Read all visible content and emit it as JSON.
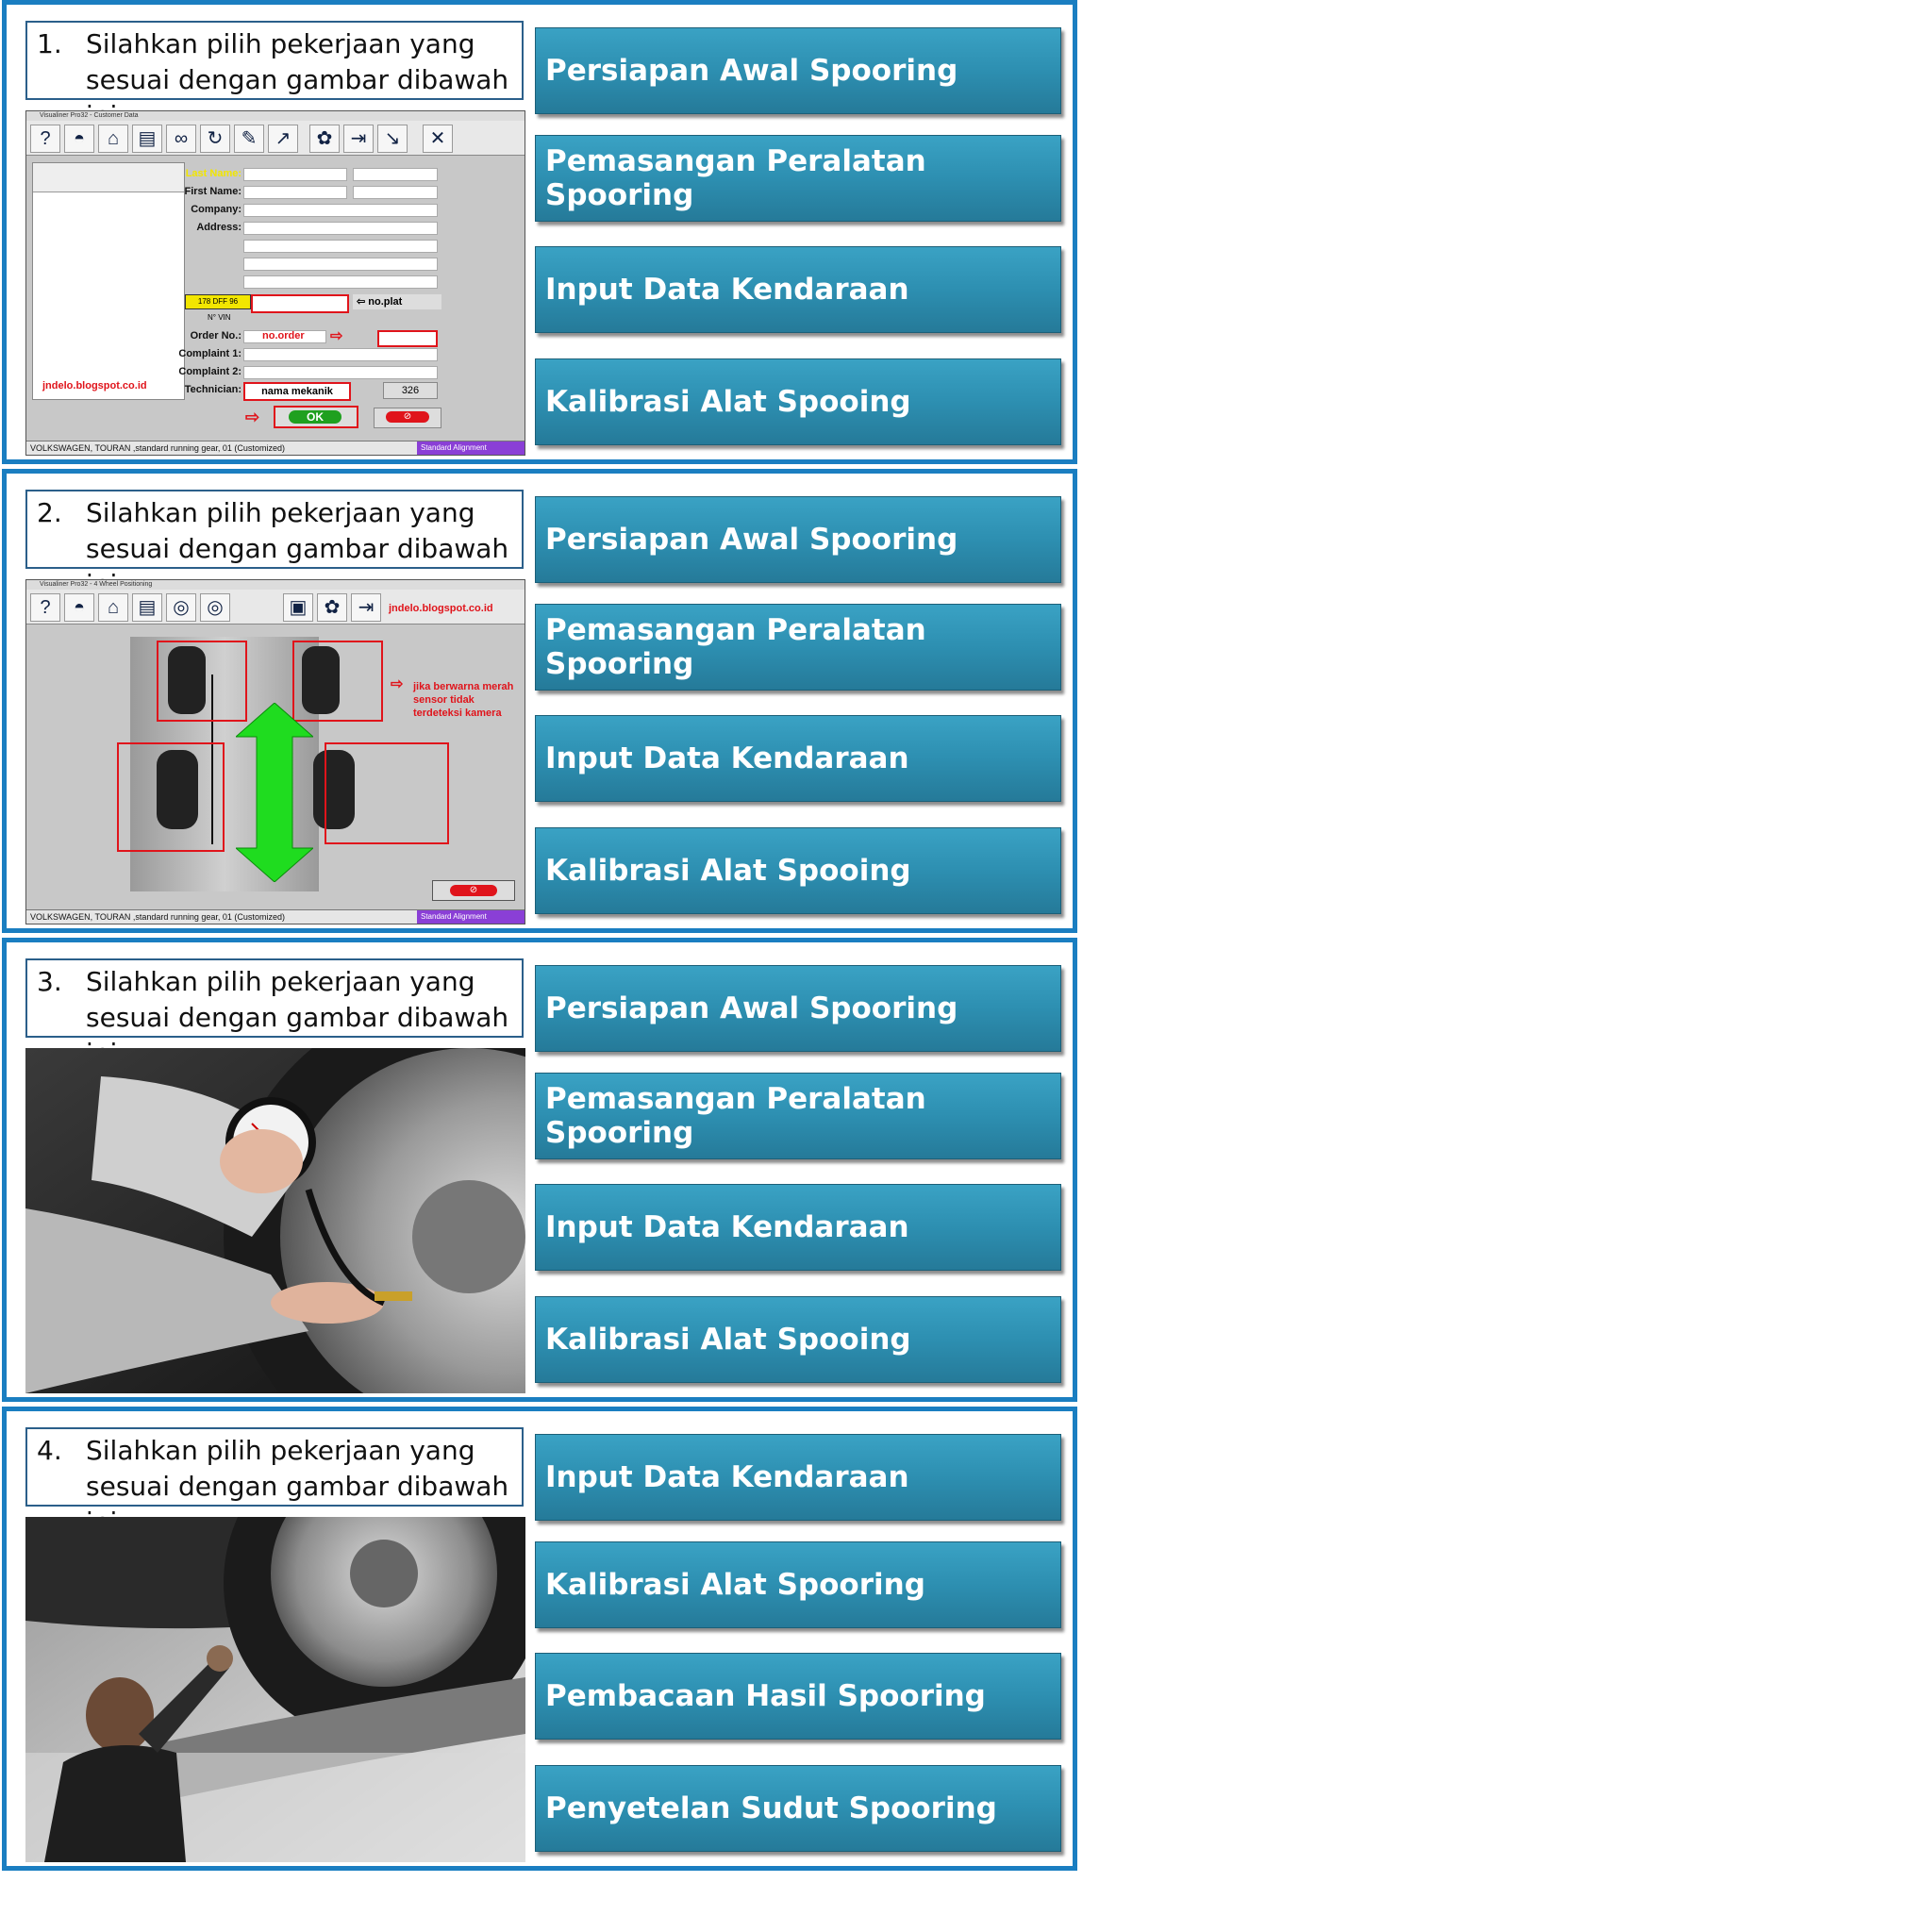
{
  "questions": [
    {
      "number": "1.",
      "text": "Silahkan pilih pekerjaan yang sesuai dengan gambar dibawah ini",
      "options": [
        "Persiapan Awal Spooring",
        "Pemasangan Peralatan Spooring",
        "Input Data Kendaraan",
        "Kalibrasi Alat Spooing"
      ],
      "screenshot": {
        "title": "Visualiner Pro32 - Customer Data",
        "labels": [
          "Last Name:",
          "First Name:",
          "Company:",
          "Address:",
          "Order No.:",
          "Complaint 1:",
          "Complaint 2:",
          "Technician:"
        ],
        "plate": "178 DFF 96",
        "vin": "N° VIN",
        "no_plat": "no.plat",
        "no_order": "no.order",
        "nama_mekanik": "nama mekanik",
        "tech_number": "326",
        "ok": "OK",
        "watermark": "jndelo.blogspot.co.id",
        "status": "VOLKSWAGEN, TOURAN ,standard running gear, 01 (Customized)",
        "status_right": "Standard Alignment"
      }
    },
    {
      "number": "2.",
      "text": "Silahkan pilih pekerjaan yang sesuai dengan gambar dibawah ini",
      "options": [
        "Persiapan Awal Spooring",
        "Pemasangan Peralatan Spooring",
        "Input Data Kendaraan",
        "Kalibrasi Alat Spooing"
      ],
      "screenshot": {
        "title": "Visualiner Pro32 - 4 Wheel Positioning",
        "watermark": "jndelo.blogspot.co.id",
        "note": "jika berwarna merah sensor tidak terdeteksi kamera",
        "status": "VOLKSWAGEN, TOURAN ,standard running gear, 01 (Customized)",
        "status_right": "Standard Alignment"
      }
    },
    {
      "number": "3.",
      "text": "Silahkan pilih pekerjaan yang sesuai dengan gambar dibawah ini",
      "options": [
        "Persiapan Awal Spooring",
        "Pemasangan Peralatan Spooring",
        "Input Data Kendaraan",
        "Kalibrasi Alat Spooing"
      ]
    },
    {
      "number": "4.",
      "text": "Silahkan pilih pekerjaan yang sesuai dengan gambar dibawah ini",
      "options": [
        "Input Data Kendaraan",
        "Kalibrasi Alat Spooring",
        "Pembacaan Hasil Spooring",
        "Penyetelan Sudut Spooring"
      ]
    }
  ],
  "colors": {
    "panel_border": "#1a7ec1",
    "button": "#2d8fb1",
    "red": "#e0141b",
    "green": "#1fdc1f"
  }
}
